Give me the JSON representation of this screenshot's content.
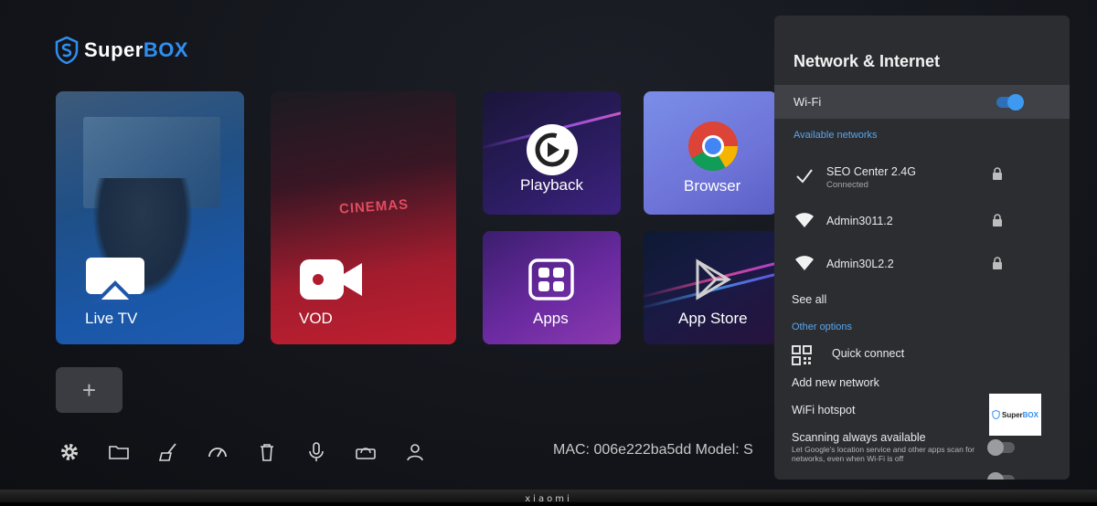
{
  "brand": {
    "name_part1": "Super",
    "name_part2": "BOX",
    "accent": "#2f8ff0"
  },
  "tiles": {
    "live_tv": "Live TV",
    "vod": "VOD",
    "vod_sign": "CINEMAS",
    "playback": "Playback",
    "browser": "Browser",
    "apps": "Apps",
    "app_store": "App Store",
    "add": "+"
  },
  "bottom_bar": {
    "icons": [
      "gear-icon",
      "folder-icon",
      "broom-icon",
      "speedometer-icon",
      "trash-icon",
      "microphone-icon",
      "router-icon",
      "user-icon"
    ],
    "mac_info": "MAC: 006e222ba5dd   Model: S"
  },
  "panel": {
    "title": "Network & Internet",
    "wifi_label": "Wi-Fi",
    "wifi_on": true,
    "available_header": "Available networks",
    "networks": [
      {
        "ssid": "SEO Center 2.4G",
        "status": "Connected"
      },
      {
        "ssid": "Admin3011.2",
        "status": ""
      },
      {
        "ssid": "Admin30L2.2",
        "status": ""
      }
    ],
    "see_all": "See all",
    "other_header": "Other options",
    "quick_connect": "Quick connect",
    "add_network": "Add new network",
    "hotspot": "WiFi hotspot",
    "scanning_title": "Scanning always available",
    "scanning_desc": "Let Google's location service and other apps scan for networks, even when Wi-Fi is off",
    "scanning_on": false,
    "thumb_logo_part1": "Super",
    "thumb_logo_part2": "BOX"
  },
  "device": {
    "bezel_brand": "xiaomi"
  }
}
